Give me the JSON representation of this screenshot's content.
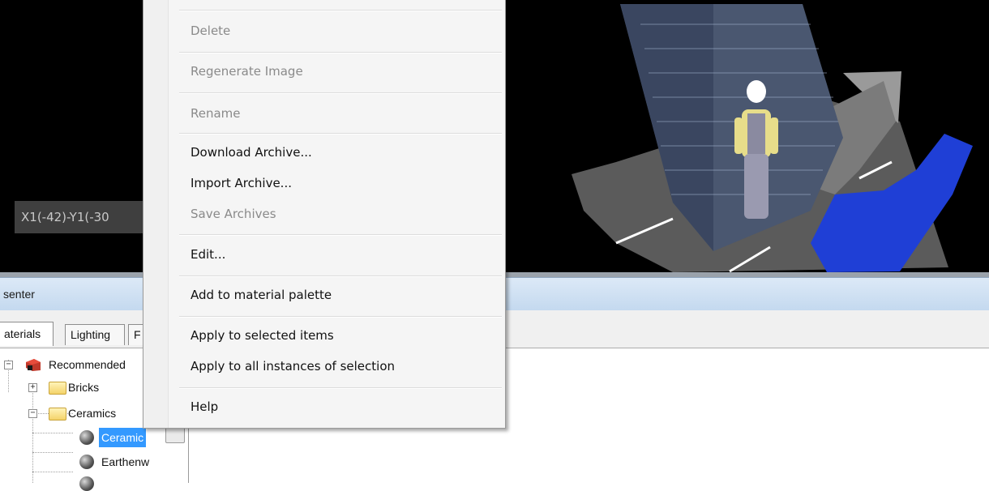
{
  "viewport": {
    "coordinate_label": "X1(-42)-Y1(-30"
  },
  "presenter": {
    "title": "senter",
    "tabs": [
      {
        "label": "aterials"
      },
      {
        "label": "Lighting"
      },
      {
        "label": "F"
      }
    ],
    "tree": {
      "root": {
        "label": "Recommended"
      },
      "bricks": {
        "label": "Bricks"
      },
      "ceramics": {
        "label": "Ceramics"
      },
      "ceramic_item": {
        "label": "Ceramic"
      },
      "earthenware_item": {
        "label": "Earthenw"
      }
    }
  },
  "context_menu": {
    "items": [
      {
        "label": "Delete",
        "enabled": false
      },
      {
        "label": "Regenerate Image",
        "enabled": false
      },
      {
        "label": "Rename",
        "enabled": false
      },
      {
        "label": "Download Archive...",
        "enabled": true
      },
      {
        "label": "Import Archive...",
        "enabled": true
      },
      {
        "label": "Save Archives",
        "enabled": false
      },
      {
        "label": "Edit...",
        "enabled": true
      },
      {
        "label": "Add to material palette",
        "enabled": true
      },
      {
        "label": "Apply to selected items",
        "enabled": true
      },
      {
        "label": "Apply to all instances of selection",
        "enabled": true
      },
      {
        "label": "Help",
        "enabled": true
      }
    ]
  },
  "colors": {
    "selection": "#3399ff",
    "viewport_background": "#000000",
    "water": "#1f3fd6"
  },
  "icons": [
    "box-icon",
    "folder-icon",
    "sphere-icon",
    "expand-icon",
    "collapse-icon"
  ]
}
